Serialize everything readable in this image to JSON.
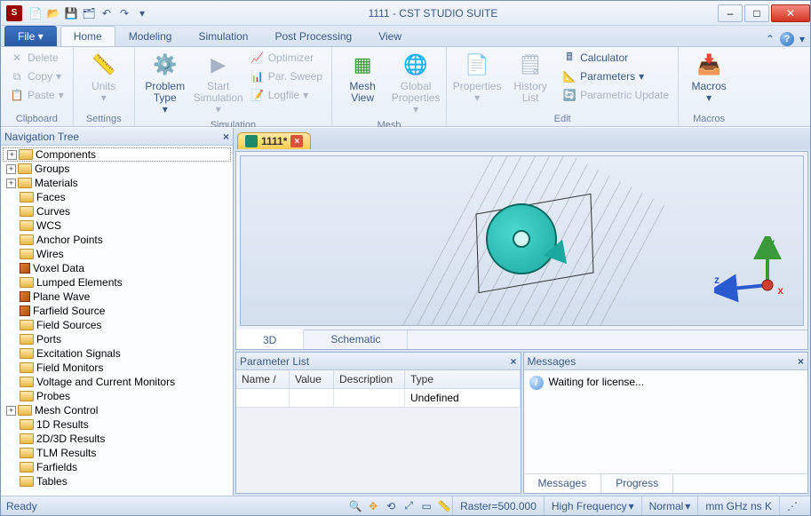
{
  "title": "1111 - CST STUDIO SUITE",
  "app_icon_letter": "S",
  "qat_icons": [
    "new",
    "open",
    "save",
    "save-all",
    "undo",
    "redo"
  ],
  "window_controls": {
    "min": "–",
    "max": "□",
    "close": "✕"
  },
  "tabs": {
    "file": "File",
    "home": "Home",
    "modeling": "Modeling",
    "simulation": "Simulation",
    "post": "Post Processing",
    "view": "View"
  },
  "ribbon": {
    "clipboard": {
      "delete": "Delete",
      "copy": "Copy",
      "paste": "Paste",
      "label": "Clipboard"
    },
    "settings": {
      "units": "Units",
      "label": "Settings"
    },
    "simulation": {
      "problem": "Problem\nType",
      "start": "Start\nSimulation",
      "optimizer": "Optimizer",
      "parsweep": "Par. Sweep",
      "logfile": "Logfile",
      "label": "Simulation"
    },
    "mesh": {
      "meshview": "Mesh\nView",
      "global": "Global\nProperties",
      "label": "Mesh"
    },
    "edit": {
      "properties": "Properties",
      "history": "History\nList",
      "calculator": "Calculator",
      "parameters": "Parameters",
      "parametric": "Parametric Update",
      "label": "Edit"
    },
    "macros": {
      "macros": "Macros",
      "label": "Macros"
    }
  },
  "nav": {
    "title": "Navigation Tree",
    "items": [
      {
        "label": "Components",
        "icon": "folder",
        "exp": "+",
        "sel": true
      },
      {
        "label": "Groups",
        "icon": "folder",
        "exp": "+"
      },
      {
        "label": "Materials",
        "icon": "folder",
        "exp": "+"
      },
      {
        "label": "Faces",
        "icon": "folder"
      },
      {
        "label": "Curves",
        "icon": "folder"
      },
      {
        "label": "WCS",
        "icon": "folder"
      },
      {
        "label": "Anchor Points",
        "icon": "folder"
      },
      {
        "label": "Wires",
        "icon": "folder"
      },
      {
        "label": "Voxel Data",
        "icon": "cube"
      },
      {
        "label": "Lumped Elements",
        "icon": "folder"
      },
      {
        "label": "Plane Wave",
        "icon": "cube"
      },
      {
        "label": "Farfield Source",
        "icon": "cube"
      },
      {
        "label": "Field Sources",
        "icon": "folder"
      },
      {
        "label": "Ports",
        "icon": "folder"
      },
      {
        "label": "Excitation Signals",
        "icon": "folder"
      },
      {
        "label": "Field Monitors",
        "icon": "folder"
      },
      {
        "label": "Voltage and Current Monitors",
        "icon": "folder"
      },
      {
        "label": "Probes",
        "icon": "folder"
      },
      {
        "label": "Mesh Control",
        "icon": "folder",
        "exp": "+"
      },
      {
        "label": "1D Results",
        "icon": "folder"
      },
      {
        "label": "2D/3D Results",
        "icon": "folder"
      },
      {
        "label": "TLM Results",
        "icon": "folder"
      },
      {
        "label": "Farfields",
        "icon": "folder"
      },
      {
        "label": "Tables",
        "icon": "folder"
      }
    ]
  },
  "doc_tab": "1111*",
  "view_tabs": {
    "d3": "3D",
    "schematic": "Schematic"
  },
  "axes": {
    "x": "x",
    "y": "y",
    "z": "z"
  },
  "param": {
    "title": "Parameter List",
    "cols": {
      "name": "Name",
      "value": "Value",
      "desc": "Description",
      "type": "Type"
    },
    "row_type": "Undefined"
  },
  "msg": {
    "title": "Messages",
    "text": "Waiting for license...",
    "tabs": {
      "messages": "Messages",
      "progress": "Progress"
    }
  },
  "status": {
    "ready": "Ready",
    "raster": "Raster=500.000",
    "freq": "High Frequency",
    "normal": "Normal",
    "units": "mm GHz ns K"
  }
}
